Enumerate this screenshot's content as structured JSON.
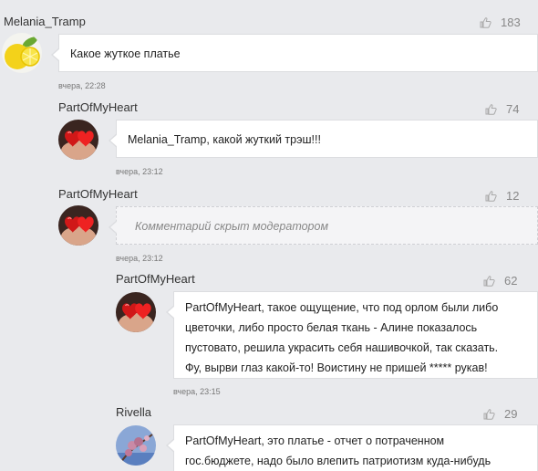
{
  "comments": [
    {
      "author": "Melania_Tramp",
      "likes": "183",
      "text_lines": [
        "Какое жуткое платье"
      ],
      "time": "вчера, 22:28",
      "avatar": "lemon-avatar"
    },
    {
      "author": "PartOfMyHeart",
      "likes": "74",
      "text_lines": [
        "Melania_Tramp, какой жуткий трэш!!!"
      ],
      "time": "вчера, 23:12",
      "avatar": "hearts-avatar"
    },
    {
      "author": "PartOfMyHeart",
      "likes": "12",
      "text_lines": [
        "Комментарий скрыт модератором"
      ],
      "time": "вчера, 23:12",
      "avatar": "hearts-avatar",
      "hidden": true
    },
    {
      "author": "PartOfMyHeart",
      "likes": "62",
      "text_lines": [
        "PartOfMyHeart, такое ощущение, что под орлом были либо",
        "цветочки, либо просто белая ткань - Алине показалось",
        "пустовато, решила украсить себя нашивочкой, так сказать.",
        "Фу, вырви глаз какой-то! Воистину не пришей ***** рукав!"
      ],
      "time": "вчера, 23:15",
      "avatar": "hearts-avatar"
    },
    {
      "author": "Rivella",
      "likes": "29",
      "text_lines": [
        "PartOfMyHeart, это платье - отчет о потраченном",
        "гос.бюджете, надо было влепить патриотизм куда-нибудь"
      ],
      "time": "",
      "avatar": "blossom-avatar"
    }
  ],
  "colors": {
    "background": "#e9eaed",
    "bubble": "#ffffff",
    "muted": "#888888"
  }
}
